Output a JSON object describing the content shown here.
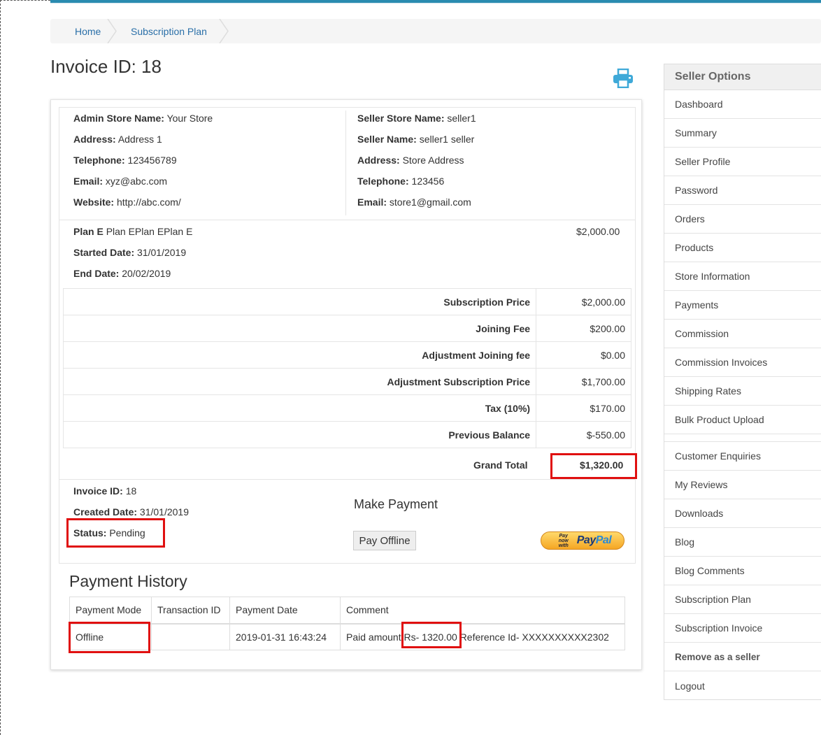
{
  "breadcrumb": {
    "home": "Home",
    "current": "Subscription Plan"
  },
  "page_title": "Invoice ID: 18",
  "icons": {
    "print": "print-icon"
  },
  "admin": {
    "store_name_label": "Admin Store Name:",
    "store_name": "Your Store",
    "address_label": "Address:",
    "address": "Address 1",
    "telephone_label": "Telephone:",
    "telephone": "123456789",
    "email_label": "Email:",
    "email": "xyz@abc.com",
    "website_label": "Website:",
    "website": "http://abc.com/"
  },
  "seller": {
    "store_name_label": "Seller Store Name:",
    "store_name": "seller1",
    "name_label": "Seller Name:",
    "name": "seller1 seller",
    "address_label": "Address:",
    "address": "Store Address",
    "telephone_label": "Telephone:",
    "telephone": "123456",
    "email_label": "Email:",
    "email": "store1@gmail.com"
  },
  "plan": {
    "name_label": "Plan E",
    "name_value": "Plan EPlan EPlan E",
    "price": "$2,000.00",
    "started_label": "Started Date:",
    "started": "31/01/2019",
    "end_label": "End Date:",
    "end": "20/02/2019"
  },
  "charges": [
    {
      "label": "Subscription Price",
      "value": "$2,000.00"
    },
    {
      "label": "Joining Fee",
      "value": "$200.00"
    },
    {
      "label": "Adjustment Joining fee",
      "value": "$0.00"
    },
    {
      "label": "Adjustment Subscription Price",
      "value": "$1,700.00"
    },
    {
      "label": "Tax (10%)",
      "value": "$170.00"
    },
    {
      "label": "Previous Balance",
      "value": "$-550.00"
    }
  ],
  "grand_total": {
    "label": "Grand Total",
    "value": "$1,320.00"
  },
  "invoice": {
    "id_label": "Invoice ID:",
    "id": "18",
    "created_label": "Created Date:",
    "created": "31/01/2019",
    "status_label": "Status:",
    "status": "Pending"
  },
  "payment": {
    "heading": "Make Payment",
    "offline_button": "Pay Offline",
    "paypal_small": "Pay now with",
    "paypal_logo_a": "Pay",
    "paypal_logo_b": "Pal"
  },
  "history": {
    "title": "Payment History",
    "columns": [
      "Payment Mode",
      "Transaction ID",
      "Payment Date",
      "Comment"
    ],
    "rows": [
      {
        "mode": "Offline",
        "transaction_id": "",
        "date": "2019-01-31 16:43:24",
        "comment_prefix": "Paid amount ",
        "comment_amount": "Rs- 1320.00",
        "comment_suffix": " Reference Id- XXXXXXXXXX2302"
      }
    ]
  },
  "sidebar": {
    "heading": "Seller Options",
    "items": [
      "Dashboard",
      "Summary",
      "Seller Profile",
      "Password",
      "Orders",
      "Products",
      "Store Information",
      "Payments",
      "Commission",
      "Commission Invoices",
      "Shipping Rates",
      "Bulk Product Upload"
    ],
    "items2": [
      "Customer Enquiries",
      "My Reviews",
      "Downloads",
      "Blog",
      "Blog Comments",
      "Subscription Plan",
      "Subscription Invoice",
      "Remove as a seller",
      "Logout"
    ]
  },
  "colors": {
    "accent": "#2a8bb0",
    "link": "#2a6fa8",
    "highlight": "#e01010",
    "print_icon": "#3fa9d8"
  }
}
